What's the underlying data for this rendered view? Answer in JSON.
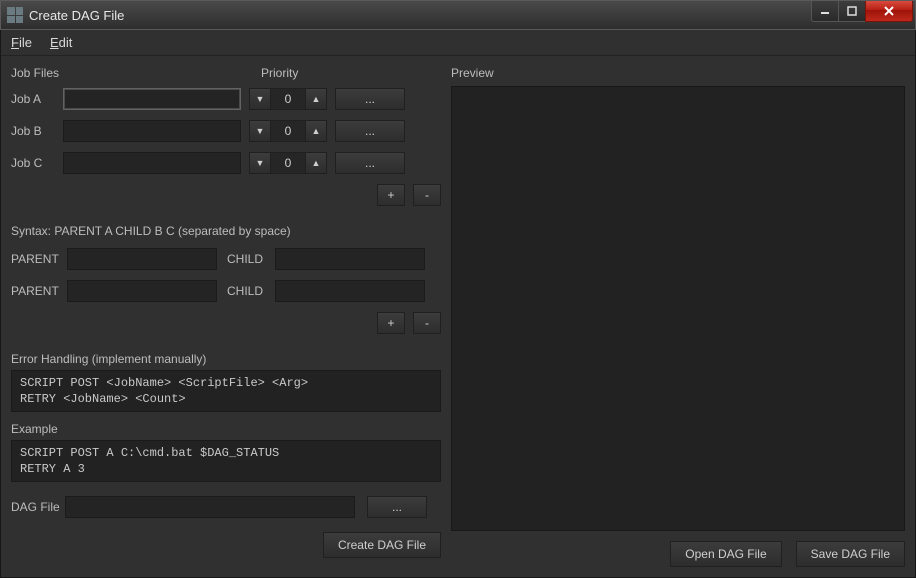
{
  "window": {
    "title": "Create DAG File"
  },
  "menu": {
    "file": "File",
    "edit": "Edit"
  },
  "left": {
    "jobfiles_header": "Job Files",
    "priority_header": "Priority",
    "jobs": [
      {
        "label": "Job A",
        "value": "",
        "priority": "0"
      },
      {
        "label": "Job B",
        "value": "",
        "priority": "0"
      },
      {
        "label": "Job C",
        "value": "",
        "priority": "0"
      }
    ],
    "browse_label": "...",
    "plus_label": "+",
    "minus_label": "-",
    "syntax_label": "Syntax: PARENT A CHILD B C (separated by space)",
    "parent_label": "PARENT",
    "child_label": "CHILD",
    "pc_rows": [
      {
        "parent": "",
        "child": ""
      },
      {
        "parent": "",
        "child": ""
      }
    ],
    "error_label": "Error Handling (implement manually)",
    "error_block": "SCRIPT POST <JobName> <ScriptFile> <Arg>\nRETRY <JobName> <Count>",
    "example_label": "Example",
    "example_block": "SCRIPT POST A C:\\cmd.bat $DAG_STATUS\nRETRY A 3",
    "dagfile_label": "DAG File",
    "dagfile_value": "",
    "create_btn": "Create DAG File"
  },
  "right": {
    "preview_label": "Preview",
    "open_btn": "Open DAG File",
    "save_btn": "Save DAG File"
  }
}
